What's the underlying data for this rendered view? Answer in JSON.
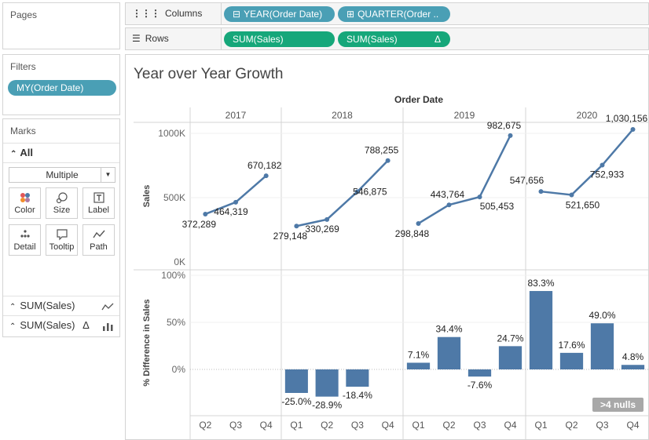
{
  "pages": {
    "title": "Pages"
  },
  "filters": {
    "title": "Filters",
    "items": [
      "MY(Order Date)"
    ]
  },
  "marks": {
    "title": "Marks",
    "all_label": "All",
    "mark_type": "Multiple",
    "buttons": [
      {
        "label": "Color",
        "icon": "color-dots-icon"
      },
      {
        "label": "Size",
        "icon": "size-icon"
      },
      {
        "label": "Label",
        "icon": "label-icon"
      },
      {
        "label": "Detail",
        "icon": "detail-icon"
      },
      {
        "label": "Tooltip",
        "icon": "tooltip-icon"
      },
      {
        "label": "Path",
        "icon": "path-icon"
      }
    ],
    "measures": [
      {
        "label": "SUM(Sales)",
        "icon": "line-chart-icon"
      },
      {
        "label": "SUM(Sales)",
        "delta": "Δ",
        "icon": "bar-chart-icon"
      }
    ]
  },
  "columns_shelf": {
    "label": "Columns",
    "pills": [
      {
        "text": "YEAR(Order Date)",
        "icon": "⊟"
      },
      {
        "text": "QUARTER(Order ..",
        "icon": "⊞"
      }
    ]
  },
  "rows_shelf": {
    "label": "Rows",
    "pills": [
      {
        "text": "SUM(Sales)"
      },
      {
        "text": "SUM(Sales)",
        "delta": "Δ"
      }
    ]
  },
  "colors": {
    "line": "#4e79a7",
    "pill_blue": "#4a9fb5",
    "pill_green": "#16a77a",
    "nulls_badge": "#a8a8a8"
  },
  "nulls_badge": ">4 nulls",
  "chart_data": {
    "type": "line+bar",
    "title": "Year over Year Growth",
    "column_header": "Order Date",
    "years": [
      "2017",
      "2018",
      "2019",
      "2020"
    ],
    "quarters": [
      [
        "Q2",
        "Q3",
        "Q4"
      ],
      [
        "Q1",
        "Q2",
        "Q3",
        "Q4"
      ],
      [
        "Q1",
        "Q2",
        "Q3",
        "Q4"
      ],
      [
        "Q1",
        "Q2",
        "Q3",
        "Q4"
      ]
    ],
    "sales": {
      "ylabel": "Sales",
      "yticks": [
        "1000K",
        "500K",
        "0K"
      ],
      "ylim": [
        0,
        1000000
      ],
      "values": [
        [
          372289,
          464319,
          670182
        ],
        [
          279148,
          330269,
          546875,
          788255
        ],
        [
          298848,
          443764,
          505453,
          982675
        ],
        [
          547656,
          521650,
          752933,
          1030156
        ]
      ],
      "labels": [
        [
          "372,289",
          "464,319",
          "670,182"
        ],
        [
          "279,148",
          "330,269",
          "546,875",
          "788,255"
        ],
        [
          "298,848",
          "443,764",
          "505,453",
          "982,675"
        ],
        [
          "547,656",
          "521,650",
          "752,933",
          "1,030,156"
        ]
      ]
    },
    "pct_diff": {
      "ylabel": "% Difference in Sales",
      "yticks": [
        "100%",
        "50%",
        "0%"
      ],
      "ylim": [
        -0.42,
        1.0
      ],
      "values": [
        [
          null,
          null,
          null
        ],
        [
          -0.25,
          -0.289,
          -0.184,
          null
        ],
        [
          0.071,
          0.344,
          -0.076,
          0.247
        ],
        [
          0.833,
          0.176,
          0.49,
          0.048
        ]
      ],
      "labels": [
        [
          "",
          "",
          ""
        ],
        [
          "-25.0%",
          "-28.9%",
          "-18.4%",
          ""
        ],
        [
          "7.1%",
          "34.4%",
          "-7.6%",
          "24.7%"
        ],
        [
          "83.3%",
          "17.6%",
          "49.0%",
          "4.8%"
        ]
      ]
    }
  }
}
